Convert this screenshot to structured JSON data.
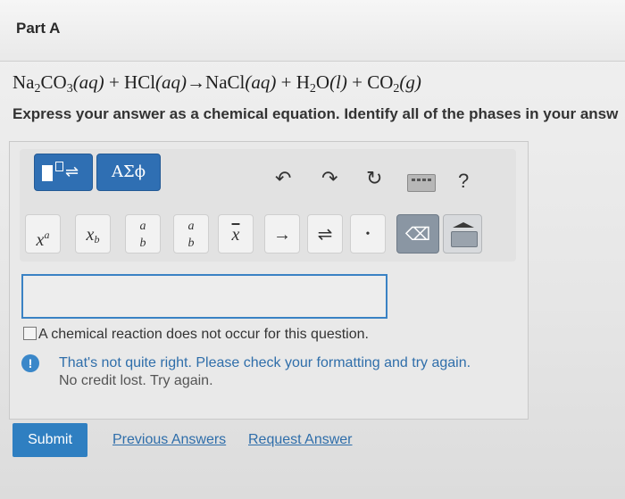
{
  "part": {
    "title": "Part A"
  },
  "equation": {
    "na": "Na",
    "na_sub": "2",
    "co": "CO",
    "co_sub": "3",
    "aq1": "(aq)",
    "plus1": " + HCl",
    "aq2": "(aq)",
    "arrow": "→NaCl",
    "aq3": "(aq)",
    "plus2": " + H",
    "h_sub": "2",
    "o": "O",
    "l": "(l)",
    "plus3": " + CO",
    "co2_sub": "2",
    "g": "(g)"
  },
  "instructions": "Express your answer as a chemical equation. Identify all of the phases in your answ",
  "toolbar": {
    "templates_icon": "templates-icon",
    "greek_label": "ΑΣϕ",
    "undo": "↶",
    "redo": "↷",
    "reset": "↻",
    "help": "?"
  },
  "keyboard": {
    "superscript": "x",
    "superscript_a": "a",
    "subscript": "x",
    "subscript_b": "b",
    "frac_a": "a",
    "frac_b": "b",
    "frac2_a": "a",
    "frac2_b": "b",
    "xbar": "x",
    "arrow": "→",
    "equilibrium": "⇌",
    "dot": "•",
    "backspace": "⌫"
  },
  "answer_input": {
    "value": ""
  },
  "no_reaction": "A chemical reaction does not occur for this question.",
  "feedback": {
    "icon": "!",
    "line1": "That's not quite right. Please check your formatting and try again.",
    "line2": "No credit lost. Try again."
  },
  "actions": {
    "submit": "Submit",
    "previous": "Previous Answers",
    "request": "Request Answer"
  }
}
